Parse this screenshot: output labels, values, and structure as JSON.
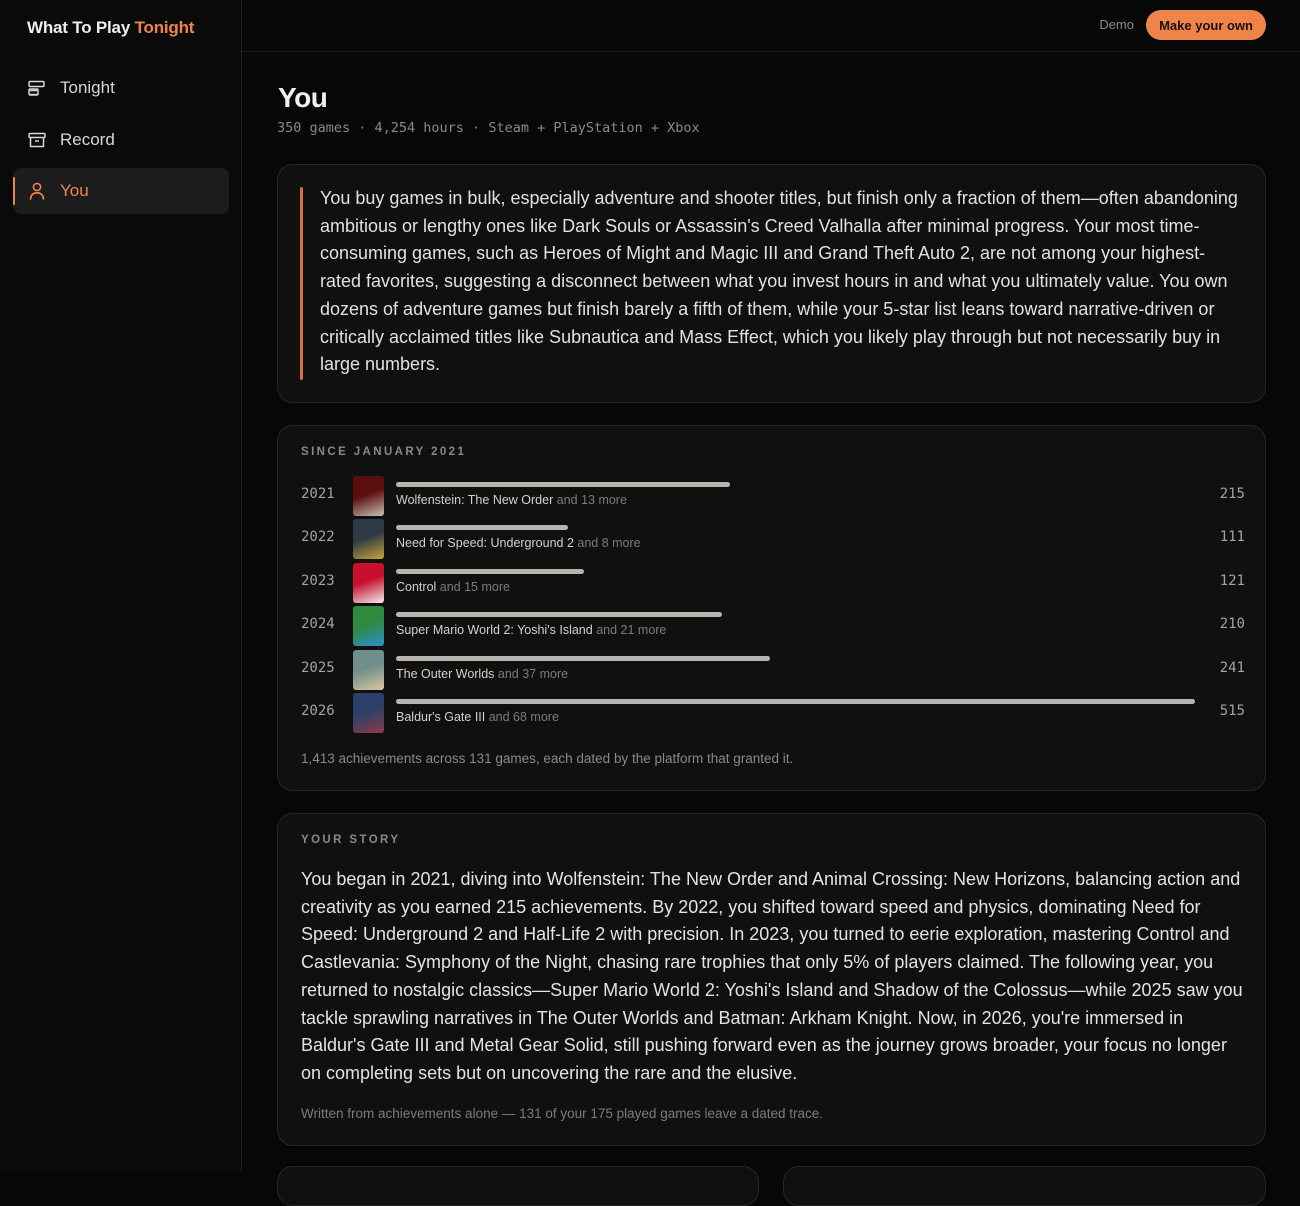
{
  "brand": {
    "part1": "What To Play ",
    "part2": "Tonight"
  },
  "nav": [
    {
      "label": "Tonight",
      "icon": "stack-icon"
    },
    {
      "label": "Record",
      "icon": "archive-icon"
    },
    {
      "label": "You",
      "icon": "user-icon",
      "active": true
    }
  ],
  "topbar": {
    "demo": "Demo",
    "cta": "Make your own"
  },
  "colors": {
    "accent": "#ef8448",
    "background": "#070707",
    "card": "#101010",
    "bar": "#b9b4ad"
  },
  "page": {
    "title": "You",
    "subtitle": "350 games · 4,254 hours · Steam + PlayStation + Xbox"
  },
  "summary": "You buy games in bulk, especially adventure and shooter titles, but finish only a fraction of them—often abandoning ambitious or lengthy ones like Dark Souls or Assassin's Creed Valhalla after minimal progress. Your most time-consuming games, such as Heroes of Might and Magic III and Grand Theft Auto 2, are not among your highest-rated favorites, suggesting a disconnect between what you invest hours in and what you ultimately value. You own dozens of adventure games but finish barely a fifth of them, while your 5-star list leans toward narrative-driven or critically acclaimed titles like Subnautica and Mass Effect, which you likely play through but not necessarily buy in large numbers.",
  "timeline": {
    "label": "SINCE JANUARY 2021",
    "max": 515,
    "rows": [
      {
        "year": "2021",
        "game": "Wolfenstein: The New Order",
        "more": "and 13 more",
        "count": 215,
        "count_label": "215",
        "cover_colors": [
          "#5a0e0e",
          "#c8bfb4"
        ]
      },
      {
        "year": "2022",
        "game": "Need for Speed: Underground 2",
        "more": "and 8 more",
        "count": 111,
        "count_label": "111",
        "cover_colors": [
          "#2b3a44",
          "#c9a23c"
        ]
      },
      {
        "year": "2023",
        "game": "Control",
        "more": "and 15 more",
        "count": 121,
        "count_label": "121",
        "cover_colors": [
          "#c8102e",
          "#f2eeee"
        ]
      },
      {
        "year": "2024",
        "game": "Super Mario World 2: Yoshi's Island",
        "more": "and 21 more",
        "count": 210,
        "count_label": "210",
        "cover_colors": [
          "#2f8a3e",
          "#2c8fd1"
        ]
      },
      {
        "year": "2025",
        "game": "The Outer Worlds",
        "more": "and 37 more",
        "count": 241,
        "count_label": "241",
        "cover_colors": [
          "#6f8f8a",
          "#d8c79c"
        ]
      },
      {
        "year": "2026",
        "game": "Baldur's Gate III",
        "more": "and 68 more",
        "count": 515,
        "count_label": "515",
        "cover_colors": [
          "#2b3f6a",
          "#8c3b4a"
        ]
      }
    ],
    "footnote": "1,413 achievements across 131 games, each dated by the platform that granted it."
  },
  "story": {
    "label": "YOUR STORY",
    "text": "You began in 2021, diving into Wolfenstein: The New Order and Animal Crossing: New Horizons, balancing action and creativity as you earned 215 achievements. By 2022, you shifted toward speed and physics, dominating Need for Speed: Underground 2 and Half-Life 2 with precision. In 2023, you turned to eerie exploration, mastering Control and Castlevania: Symphony of the Night, chasing rare trophies that only 5% of players claimed. The following year, you returned to nostalgic classics—Super Mario World 2: Yoshi's Island and Shadow of the Colossus—while 2025 saw you tackle sprawling narratives in The Outer Worlds and Batman: Arkham Knight. Now, in 2026, you're immersed in Baldur's Gate III and Metal Gear Solid, still pushing forward even as the journey grows broader, your focus no longer on completing sets but on uncovering the rare and the elusive.",
    "footnote": "Written from achievements alone — 131 of your 175 played games leave a dated trace."
  }
}
